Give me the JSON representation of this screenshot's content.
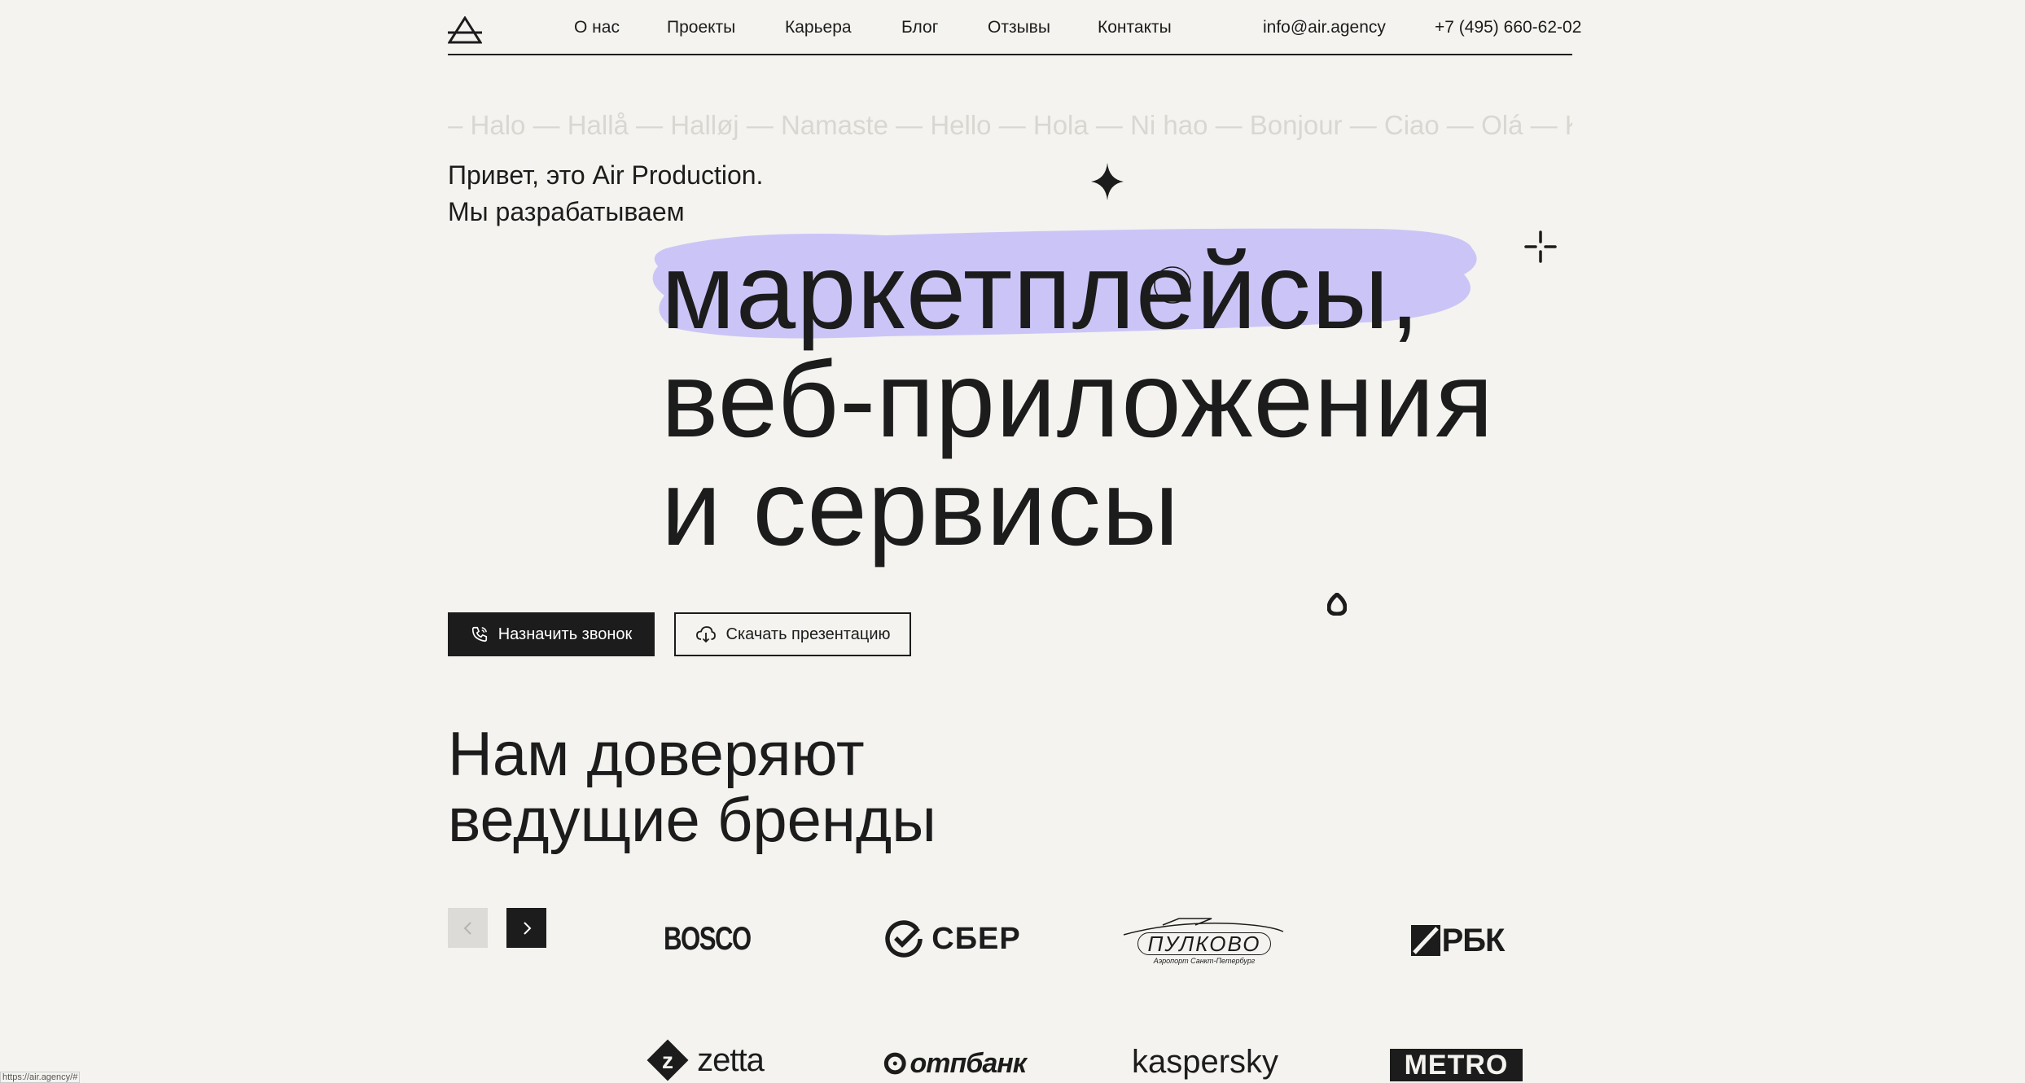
{
  "nav": {
    "items": [
      {
        "label": "О нас"
      },
      {
        "label": "Проекты"
      },
      {
        "label": "Карьера"
      },
      {
        "label": "Блог"
      },
      {
        "label": "Отзывы"
      },
      {
        "label": "Контакты"
      }
    ],
    "email": "info@air.agency",
    "phone": "+7 (495) 660-62-02"
  },
  "ticker": {
    "text": "– Halo — Hallå — Halløj — Namaste — Hello — Hola — Ni hao — Bonjour — Ciao — Olá — Konnichiwa"
  },
  "intro": {
    "line1": "Привет, это Air Production.",
    "line2": "Мы разрабатываем"
  },
  "hero": {
    "line1": "маркетплейсы,",
    "line2": "веб-приложения",
    "line3": "и сервисы"
  },
  "buttons": {
    "call": "Назначить звонок",
    "presentation": "Скачать презентацию"
  },
  "brands": {
    "title_line1": "Нам доверяют",
    "title_line2": "ведущие бренды",
    "logos": [
      {
        "text": "BOSCO",
        "icon": "bosco-logo"
      },
      {
        "text": "СБЕР",
        "icon": "sber-logo"
      },
      {
        "text": "ПУЛКОВО",
        "sub": "Аэропорт Санкт-Петербург",
        "icon": "pulkovo-logo"
      },
      {
        "text": "РБК",
        "icon": "rbk-logo"
      },
      {
        "text": "zetta",
        "icon": "zetta-logo"
      },
      {
        "text": "отпбанк",
        "icon": "otpbank-logo"
      },
      {
        "text": "kaspersky",
        "icon": "kaspersky-logo"
      },
      {
        "text": "METRO",
        "icon": "metro-logo"
      }
    ]
  },
  "status": {
    "url": "https://air.agency/#"
  },
  "colors": {
    "highlight": "#cbc5f7",
    "dark": "#1c1c1c",
    "background": "#f4f3ef"
  }
}
